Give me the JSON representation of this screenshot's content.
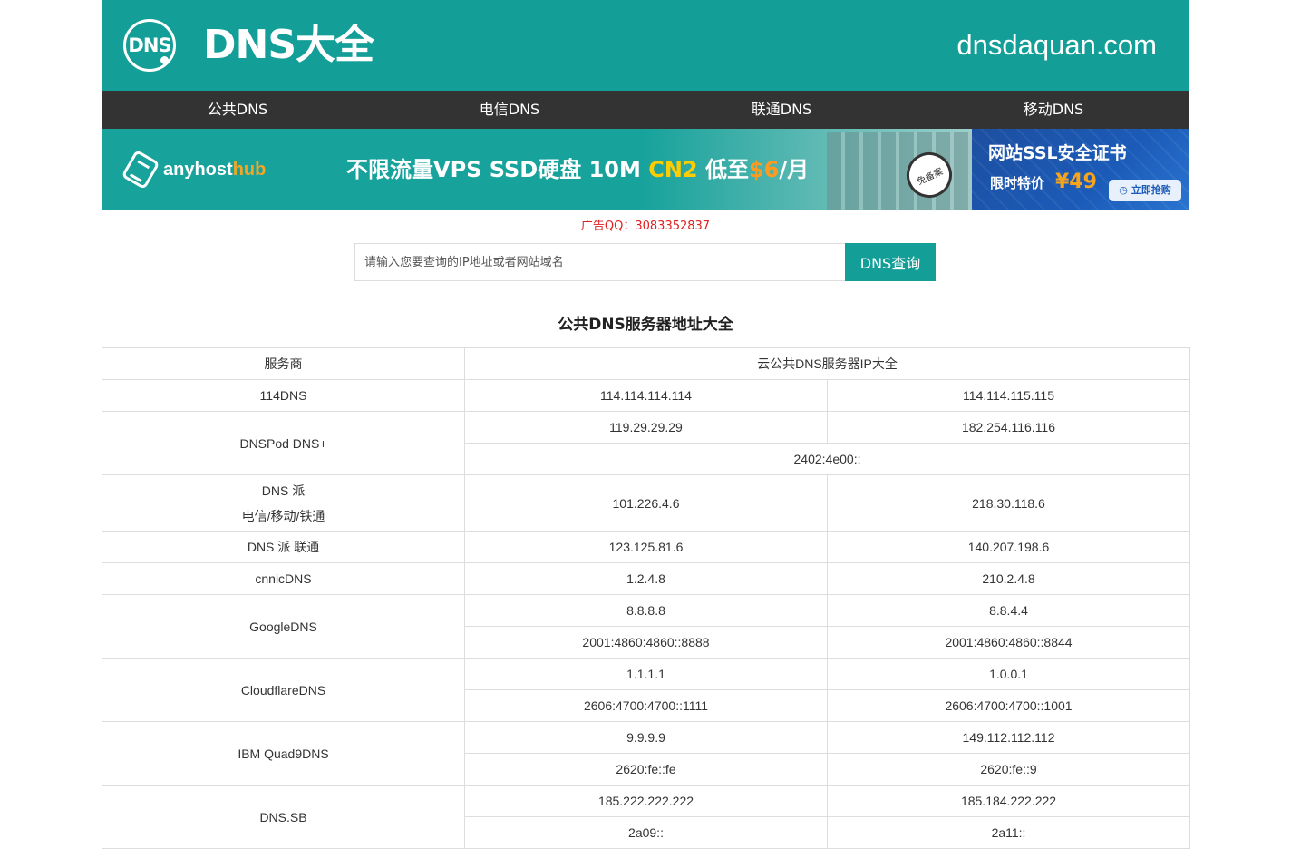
{
  "header": {
    "logo_mark": "DNS",
    "logo_text": "DNS大全",
    "domain": "dnsdaquan.com"
  },
  "nav": [
    {
      "label": "公共DNS"
    },
    {
      "label": "电信DNS"
    },
    {
      "label": "联通DNS"
    },
    {
      "label": "移动DNS"
    }
  ],
  "banner": {
    "brand_a": "anyhost",
    "brand_b": "hub",
    "slogan_a": "不限流量VPS SSD硬盘 10M ",
    "slogan_cn2": "CN2",
    "slogan_b": " 低至",
    "slogan_price": "$6",
    "slogan_c": "/月",
    "stamp": "免备案"
  },
  "ssl_ad": {
    "title": "网站SSL安全证书",
    "price_label": "限时特价",
    "price": "¥49",
    "button": "立即抢购"
  },
  "ad_qq": "广告QQ：3083352837",
  "search": {
    "placeholder": "请输入您要查询的IP地址或者网站域名",
    "button": "DNS查询"
  },
  "section_title": "公共DNS服务器地址大全",
  "table": {
    "headers": {
      "provider": "服务商",
      "ips": "云公共DNS服务器IP大全"
    },
    "rows": [
      {
        "provider": "114DNS",
        "ip_rows": [
          [
            "114.114.114.114",
            "114.114.115.115"
          ]
        ]
      },
      {
        "provider": "DNSPod DNS+",
        "ip_rows": [
          [
            "119.29.29.29",
            "182.254.116.116"
          ],
          [
            "2402:4e00::"
          ]
        ]
      },
      {
        "provider_line1": "DNS 派",
        "provider_line2": "电信/移动/铁通",
        "ip_rows": [
          [
            "101.226.4.6",
            "218.30.118.6"
          ]
        ]
      },
      {
        "provider": "DNS 派 联通",
        "ip_rows": [
          [
            "123.125.81.6",
            "140.207.198.6"
          ]
        ]
      },
      {
        "provider": "cnnicDNS",
        "ip_rows": [
          [
            "1.2.4.8",
            "210.2.4.8"
          ]
        ]
      },
      {
        "provider": "GoogleDNS",
        "ip_rows": [
          [
            "8.8.8.8",
            "8.8.4.4"
          ],
          [
            "2001:4860:4860::8888",
            "2001:4860:4860::8844"
          ]
        ]
      },
      {
        "provider": "CloudflareDNS",
        "ip_rows": [
          [
            "1.1.1.1",
            "1.0.0.1"
          ],
          [
            "2606:4700:4700::1111",
            "2606:4700:4700::1001"
          ]
        ]
      },
      {
        "provider": "IBM Quad9DNS",
        "ip_rows": [
          [
            "9.9.9.9",
            "149.112.112.112"
          ],
          [
            "2620:fe::fe",
            "2620:fe::9"
          ]
        ]
      },
      {
        "provider": "DNS.SB",
        "ip_rows": [
          [
            "185.222.222.222",
            "185.184.222.222"
          ],
          [
            "2a09::",
            "2a11::"
          ]
        ]
      }
    ]
  }
}
